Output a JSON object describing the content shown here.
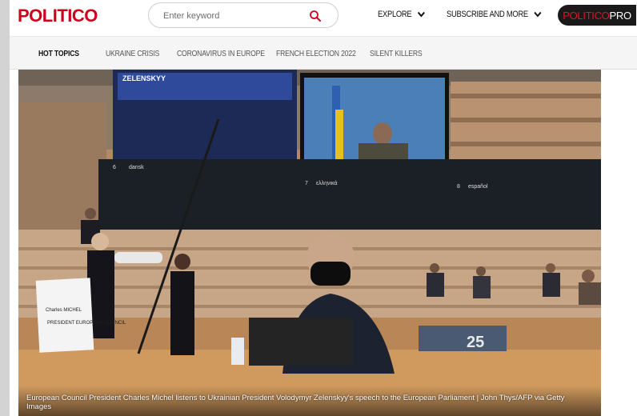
{
  "header": {
    "logo": "POLITICO",
    "search_placeholder": "Enter keyword",
    "nav": [
      {
        "label": "EXPLORE"
      },
      {
        "label": "SUBSCRIBE AND MORE"
      }
    ],
    "pro_button": {
      "part1": "POLITICO",
      "part2": "PRO"
    }
  },
  "topics": {
    "hot_label": "HOT TOPICS",
    "items": [
      {
        "label": "UKRAINE CRISIS"
      },
      {
        "label": "CORONAVIRUS IN EUROPE"
      },
      {
        "label": "FRENCH ELECTION 2022"
      },
      {
        "label": "SILENT KILLERS"
      }
    ]
  },
  "hero": {
    "screen_name": "ZELENSKYY",
    "booth_labels": [
      "6",
      "dansk",
      "7",
      "ελληνικά",
      "8",
      "español"
    ],
    "placard_name": "Charles MICHEL",
    "placard_role": "PRESIDENT EUROPEAN COUNCIL",
    "seat_number": "25",
    "caption": "European Council President Charles Michel listens to Ukrainian President Volodymyr Zelenskyy's speech to the European Parliament | John Thys/AFP via Getty Images"
  },
  "colors": {
    "brand_red": "#d0021b",
    "pro_bg": "#1a1a1a",
    "topics_bg": "#f5f5f5"
  },
  "icons": {
    "search": "search-icon",
    "chevron": "chevron-down-icon"
  }
}
